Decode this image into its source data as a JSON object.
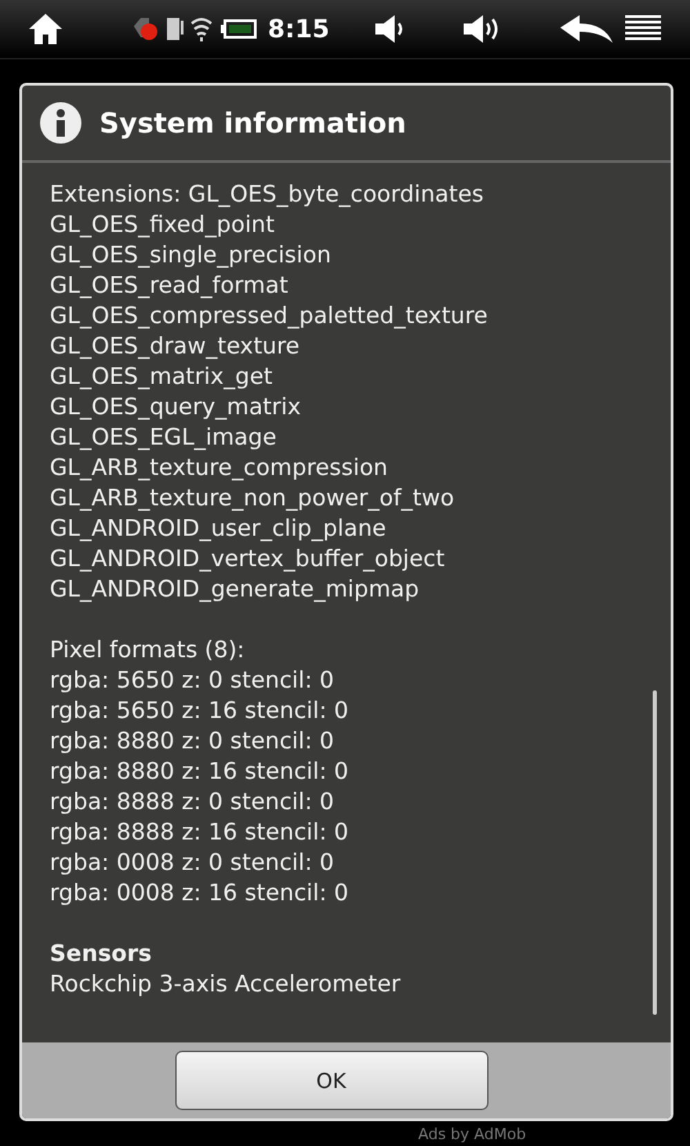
{
  "status_bar": {
    "time": "8:15"
  },
  "dialog": {
    "title": "System information",
    "sections": [
      {
        "lines": [
          "Extensions: GL_OES_byte_coordinates",
          "GL_OES_fixed_point",
          "GL_OES_single_precision",
          "GL_OES_read_format",
          "GL_OES_compressed_paletted_texture",
          "GL_OES_draw_texture",
          "GL_OES_matrix_get",
          "GL_OES_query_matrix",
          "GL_OES_EGL_image",
          "GL_ARB_texture_compression",
          "GL_ARB_texture_non_power_of_two",
          "GL_ANDROID_user_clip_plane",
          "GL_ANDROID_vertex_buffer_object",
          "GL_ANDROID_generate_mipmap"
        ]
      },
      {
        "lines": [
          "Pixel formats (8):",
          "rgba: 5650 z: 0 stencil: 0",
          "rgba: 5650 z: 16 stencil: 0",
          "rgba: 8880 z: 0 stencil: 0",
          "rgba: 8880 z: 16 stencil: 0",
          "rgba: 8888 z: 0 stencil: 0",
          "rgba: 8888 z: 16 stencil: 0",
          "rgba: 0008 z: 0 stencil: 0",
          "rgba: 0008 z: 16 stencil: 0"
        ]
      },
      {
        "heading": "Sensors",
        "lines": [
          "Rockchip 3-axis Accelerometer"
        ]
      }
    ],
    "button": "OK"
  },
  "ad_text": "Ads by AdMob"
}
